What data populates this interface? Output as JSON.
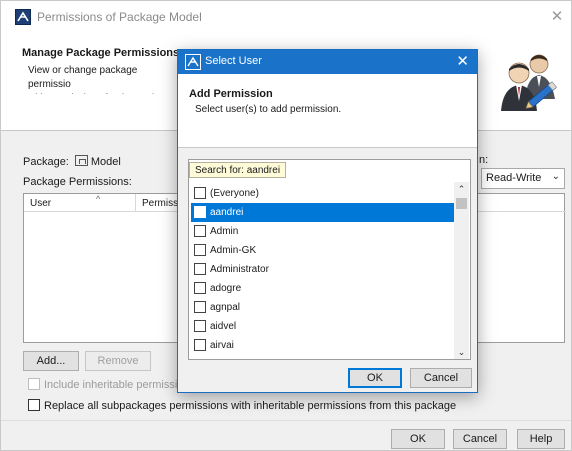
{
  "main_window": {
    "title": "Permissions of Package Model",
    "close_glyph": "✕",
    "header": {
      "title": "Manage Package Permissions",
      "description": "View or change package permissio\nwith permissions for the package c"
    },
    "package_label": "Package:",
    "package_name": "Model",
    "permissions_label": "Package Permissions:",
    "permission_right_label": "n:",
    "permission_select_value": "Read-Write",
    "table": {
      "columns": [
        "User",
        "Permissi"
      ],
      "sort_indicator": "^",
      "rows": []
    },
    "add_button": "Add...",
    "remove_button": "Remove",
    "include_inherit_label": "Include inheritable permissions",
    "replace_label": "Replace all subpackages permissions with inheritable permissions from this package",
    "ok_button": "OK",
    "cancel_button": "Cancel",
    "help_button": "Help"
  },
  "select_user_dialog": {
    "title": "Select User",
    "close_glyph": "✕",
    "header_title": "Add Permission",
    "header_description": "Select user(s) to add permission.",
    "search_tip": "Search for: aandrei",
    "users": [
      {
        "name": "(Everyone)",
        "checked": false,
        "selected": false
      },
      {
        "name": "aandrei",
        "checked": false,
        "selected": true
      },
      {
        "name": "Admin",
        "checked": false,
        "selected": false
      },
      {
        "name": "Admin-GK",
        "checked": false,
        "selected": false
      },
      {
        "name": "Administrator",
        "checked": false,
        "selected": false
      },
      {
        "name": "adogre",
        "checked": false,
        "selected": false
      },
      {
        "name": "agnpal",
        "checked": false,
        "selected": false
      },
      {
        "name": "aidvel",
        "checked": false,
        "selected": false
      },
      {
        "name": "airvai",
        "checked": false,
        "selected": false
      }
    ],
    "ok_button": "OK",
    "cancel_button": "Cancel"
  },
  "colors": {
    "accent": "#0078d7",
    "titlebar_active": "#1a73c8",
    "dialog_bg": "#f0f0f0"
  },
  "icons": {
    "app": "magicdraw-app-icon",
    "header_art": "users-with-pencil-icon",
    "package": "package-icon",
    "scroll_up": "chevron-up-icon",
    "scroll_down": "chevron-down-icon"
  }
}
